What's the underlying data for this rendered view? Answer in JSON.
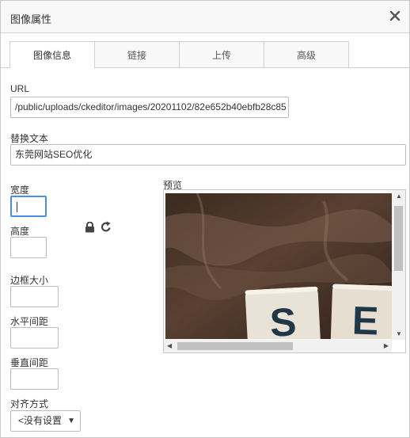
{
  "dialog": {
    "title": "图像属性"
  },
  "tabs": [
    {
      "label": "图像信息",
      "active": true
    },
    {
      "label": "链接",
      "active": false
    },
    {
      "label": "上传",
      "active": false
    },
    {
      "label": "高级",
      "active": false
    }
  ],
  "form": {
    "url_label": "URL",
    "url_value": "/public/uploads/ckeditor/images/20201102/82e652b40ebfb28c85",
    "alt_label": "替换文本",
    "alt_value": "东莞网站SEO优化",
    "width_label": "宽度",
    "width_value": "",
    "height_label": "高度",
    "height_value": "",
    "border_label": "边框大小",
    "border_value": "",
    "hspace_label": "水平间距",
    "hspace_value": "",
    "vspace_label": "垂直间距",
    "vspace_value": "",
    "align_label": "对齐方式",
    "align_value": "<没有设置",
    "preview_label": "预览"
  },
  "icons": {
    "close": "close-icon",
    "lock": "lock-icon",
    "reset": "reset-size-icon"
  },
  "colors": {
    "focus": "#4a90e2",
    "border": "#bcbcbc"
  }
}
